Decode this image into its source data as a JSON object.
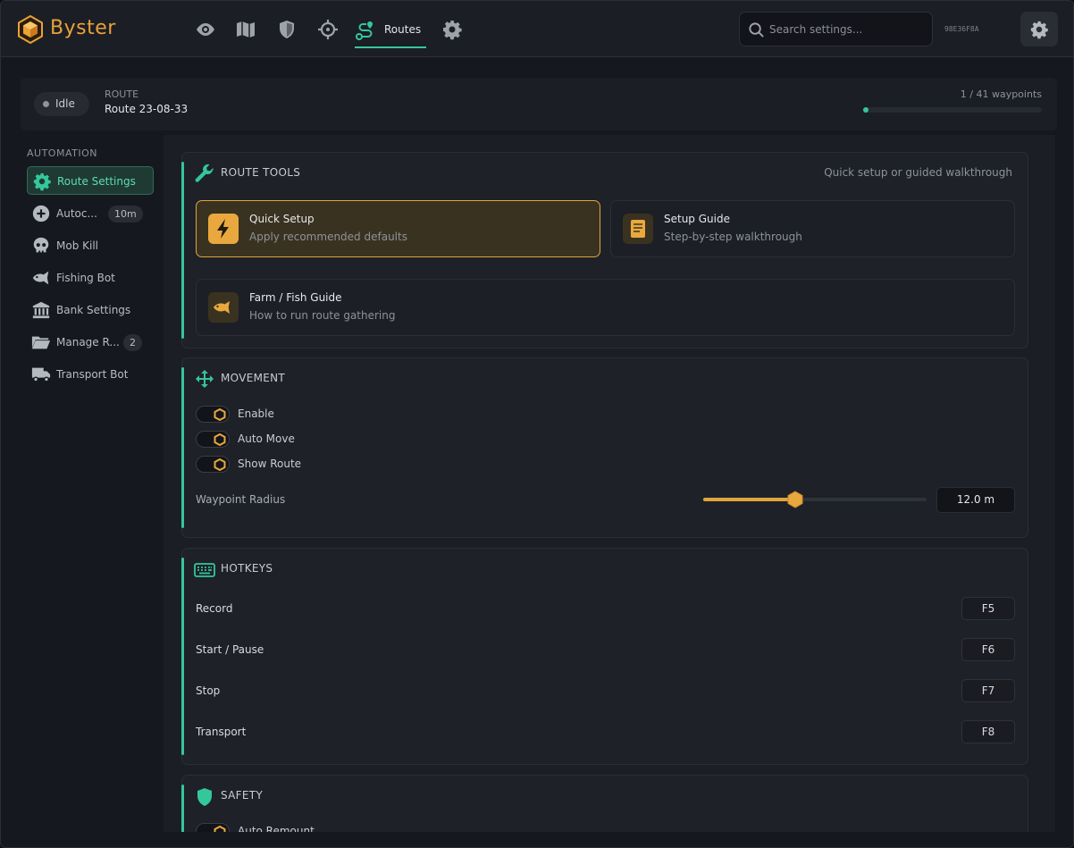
{
  "app": {
    "brand": "Byster",
    "hwid": "98E36F8A"
  },
  "nav": {
    "routes_label": "Routes",
    "icons": [
      "eye-icon",
      "map-icon",
      "shield-icon",
      "crosshair-icon",
      "route-icon",
      "gear-icon"
    ]
  },
  "search": {
    "placeholder": "Search settings..."
  },
  "status": {
    "state": "Idle",
    "route_caption": "ROUTE",
    "route_name": "Route 23-08-33",
    "waypoints_label": "1 / 41 waypoints",
    "progress_fraction": 0.024
  },
  "sidebar": {
    "title": "AUTOMATION",
    "items": [
      {
        "label": "Route Settings",
        "icon": "gear-icon",
        "badge": ""
      },
      {
        "label": "Autoc...",
        "icon": "plus-circle-icon",
        "badge": "10m"
      },
      {
        "label": "Mob Kill",
        "icon": "skull-icon",
        "badge": ""
      },
      {
        "label": "Fishing Bot",
        "icon": "fish-icon",
        "badge": ""
      },
      {
        "label": "Bank Settings",
        "icon": "bank-icon",
        "badge": ""
      },
      {
        "label": "Manage R...",
        "icon": "folder-icon",
        "badge": "2"
      },
      {
        "label": "Transport Bot",
        "icon": "truck-icon",
        "badge": ""
      }
    ]
  },
  "route_tools": {
    "title": "ROUTE TOOLS",
    "hint": "Quick setup or guided walkthrough",
    "tools": [
      {
        "name": "Quick Setup",
        "desc": "Apply recommended defaults",
        "icon": "bolt-icon"
      },
      {
        "name": "Setup Guide",
        "desc": "Step-by-step walkthrough",
        "icon": "book-icon"
      },
      {
        "name": "Farm / Fish Guide",
        "desc": "How to run route gathering",
        "icon": "fish-icon"
      }
    ]
  },
  "movement": {
    "title": "MOVEMENT",
    "toggles": [
      {
        "label": "Enable"
      },
      {
        "label": "Auto Move"
      },
      {
        "label": "Show Route"
      }
    ],
    "slider_label": "Waypoint Radius",
    "slider_fraction": 0.41,
    "slider_value": "12.0 m"
  },
  "hotkeys": {
    "title": "HOTKEYS",
    "rows": [
      {
        "label": "Record",
        "key": "F5"
      },
      {
        "label": "Start / Pause",
        "key": "F6"
      },
      {
        "label": "Stop",
        "key": "F7"
      },
      {
        "label": "Transport",
        "key": "F8"
      }
    ]
  },
  "safety": {
    "title": "SAFETY",
    "toggles": [
      {
        "label": "Auto Remount"
      }
    ]
  },
  "colors": {
    "accent": "#34c79a",
    "highlight": "#e0a43e",
    "background": "#15181e"
  }
}
